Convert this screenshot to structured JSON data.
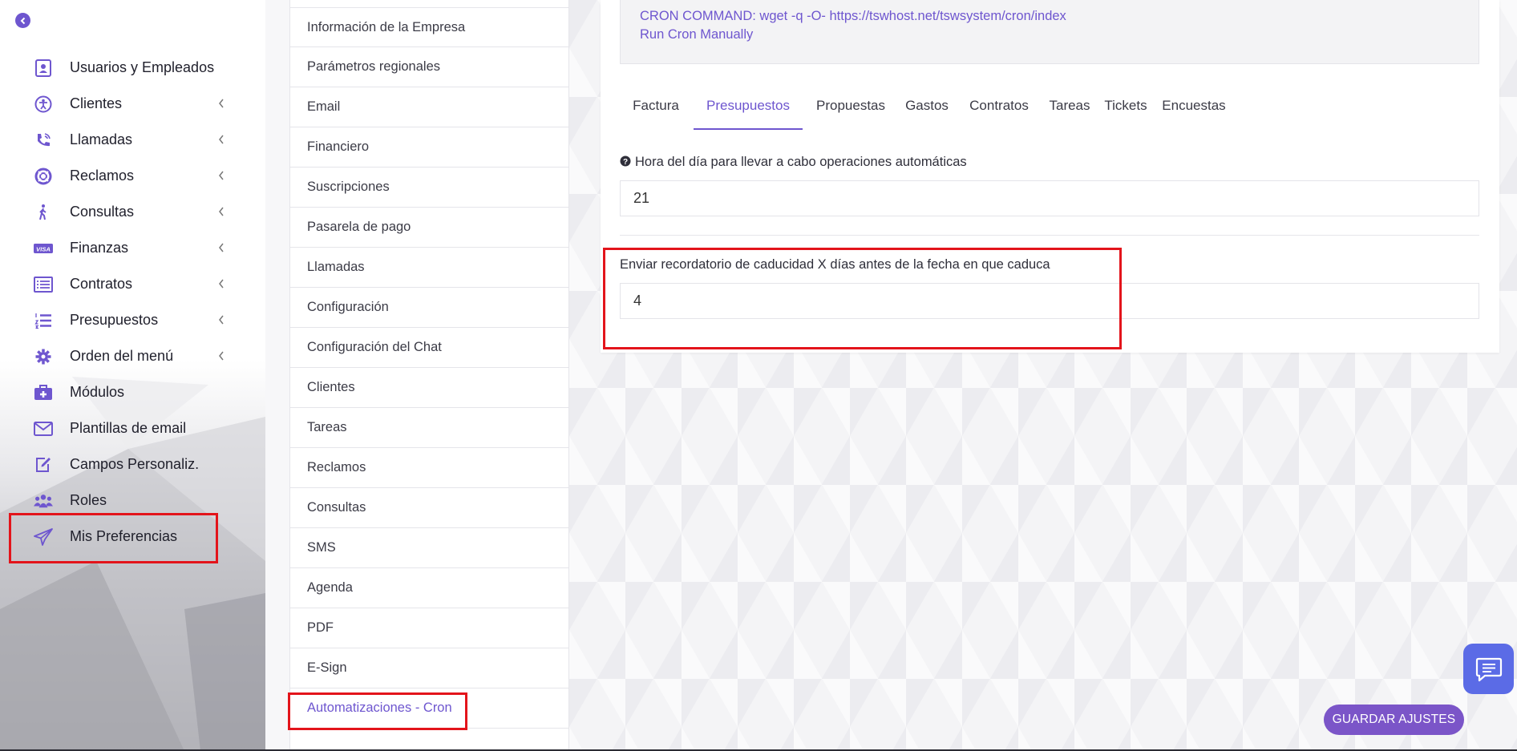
{
  "sidebar": {
    "items": [
      {
        "label": "Usuarios y Empleados",
        "icon": "user-card-icon",
        "has_submenu": false
      },
      {
        "label": "Clientes",
        "icon": "accessibility-icon",
        "has_submenu": true
      },
      {
        "label": "Llamadas",
        "icon": "phone-ringing-icon",
        "has_submenu": true
      },
      {
        "label": "Reclamos",
        "icon": "lifebuoy-icon",
        "has_submenu": true
      },
      {
        "label": "Consultas",
        "icon": "walking-person-icon",
        "has_submenu": true
      },
      {
        "label": "Finanzas",
        "icon": "visa-card-icon",
        "has_submenu": true
      },
      {
        "label": "Contratos",
        "icon": "list-box-icon",
        "has_submenu": true
      },
      {
        "label": "Presupuestos",
        "icon": "numbered-list-icon",
        "has_submenu": true
      },
      {
        "label": "Orden del menú",
        "icon": "gear-icon",
        "has_submenu": true
      },
      {
        "label": "Módulos",
        "icon": "medkit-icon",
        "has_submenu": false
      },
      {
        "label": "Plantillas de email",
        "icon": "envelope-icon",
        "has_submenu": false
      },
      {
        "label": "Campos Personaliz.",
        "icon": "edit-square-icon",
        "has_submenu": false
      },
      {
        "label": "Roles",
        "icon": "users-group-icon",
        "has_submenu": false
      },
      {
        "label": "Mis Preferencias",
        "icon": "paper-plane-icon",
        "has_submenu": false
      }
    ]
  },
  "settings_menu": {
    "items": [
      "Información de la Empresa",
      "Parámetros regionales",
      "Email",
      "Financiero",
      "Suscripciones",
      "Pasarela de pago",
      "Llamadas",
      "Configuración",
      "Configuración del Chat",
      "Clientes",
      "Tareas",
      "Reclamos",
      "Consultas",
      "SMS",
      "Agenda",
      "PDF",
      "E-Sign",
      "Automatizaciones - Cron"
    ],
    "active": "Automatizaciones - Cron"
  },
  "cron": {
    "command": "CRON COMMAND: wget -q -O- https://tswhost.net/tswsystem/cron/index",
    "run_manually": "Run Cron Manually"
  },
  "tabs": {
    "items": [
      "Factura",
      "Presupuestos",
      "Propuestas",
      "Gastos",
      "Contratos",
      "Tareas",
      "Tickets",
      "Encuestas"
    ],
    "active": "Presupuestos"
  },
  "fields": {
    "hour_label": "Hora del día para llevar a cabo operaciones automáticas",
    "hour_value": "21",
    "reminder_label": "Enviar recordatorio de caducidad X días antes de la fecha en que caduca",
    "reminder_value": "4"
  },
  "buttons": {
    "save": "GUARDAR AJUSTES"
  },
  "colors": {
    "accent": "#6e56cf",
    "highlight": "#e3141b",
    "chat": "#5b6be6"
  }
}
